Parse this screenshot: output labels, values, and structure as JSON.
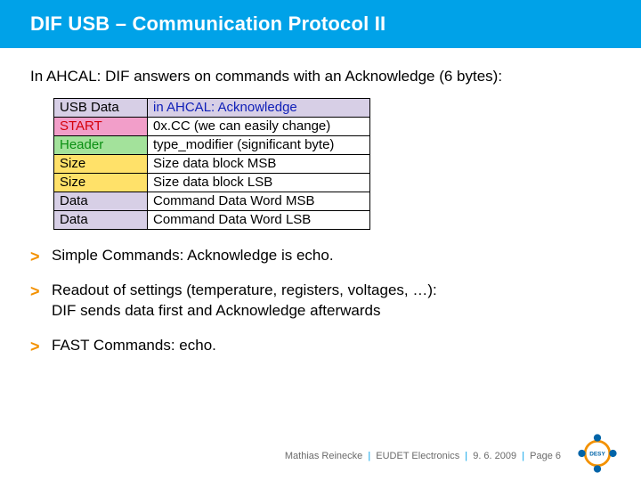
{
  "title": "DIF USB – Communication Protocol II",
  "lead": "In AHCAL: DIF answers on commands with an Acknowledge (6 bytes):",
  "table": {
    "head": {
      "left": "USB Data",
      "right": "in AHCAL: Acknowledge"
    },
    "rows": [
      {
        "cls": "row-start",
        "left": "START",
        "right": "0x.CC (we can easily change)"
      },
      {
        "cls": "row-header",
        "left": "Header",
        "right": "type_modifier (significant byte)"
      },
      {
        "cls": "row-size",
        "left": "Size",
        "right": "Size data block MSB"
      },
      {
        "cls": "row-size",
        "left": "Size",
        "right": "Size data block LSB"
      },
      {
        "cls": "row-data",
        "left": "Data",
        "right": "Command Data Word MSB"
      },
      {
        "cls": "row-data",
        "left": "Data",
        "right": "Command Data Word LSB"
      }
    ]
  },
  "bullets": [
    "Simple Commands: Acknowledge is echo.",
    "Readout of settings (temperature, registers, voltages, …):\nDIF sends data first and Acknowledge afterwards",
    "FAST Commands: echo."
  ],
  "footer": {
    "author": "Mathias Reinecke",
    "event": "EUDET Electronics",
    "date": "9. 6. 2009",
    "page": "Page 6"
  },
  "logo_label": "DESY"
}
